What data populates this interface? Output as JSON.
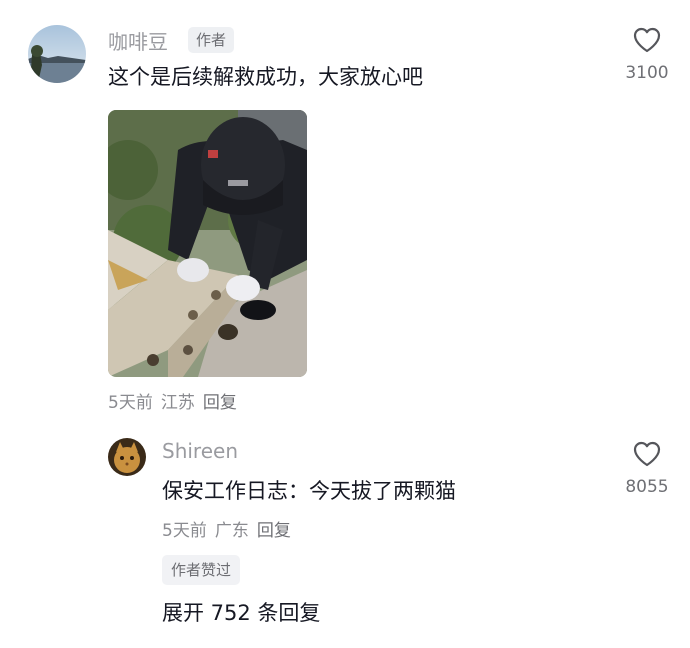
{
  "comment": {
    "username": "咖啡豆",
    "author_tag": "作者",
    "text": "这个是后续解救成功，大家放心吧",
    "like_count": "3100",
    "time": "5天前",
    "location": "江苏",
    "reply_label": "回复",
    "image_icon": "photo-security-guard-rescuing-cat"
  },
  "reply": {
    "username": "Shireen",
    "text": "保安工作日志：今天拔了两颗猫",
    "like_count": "8055",
    "time": "5天前",
    "location": "广东",
    "reply_label": "回复",
    "liked_by_author_tag": "作者赞过"
  },
  "expand_replies_label": "展开 752 条回复",
  "colors": {
    "text_primary": "#161823",
    "text_secondary": "#9a9ba0",
    "tag_bg": "#eef0f3"
  }
}
